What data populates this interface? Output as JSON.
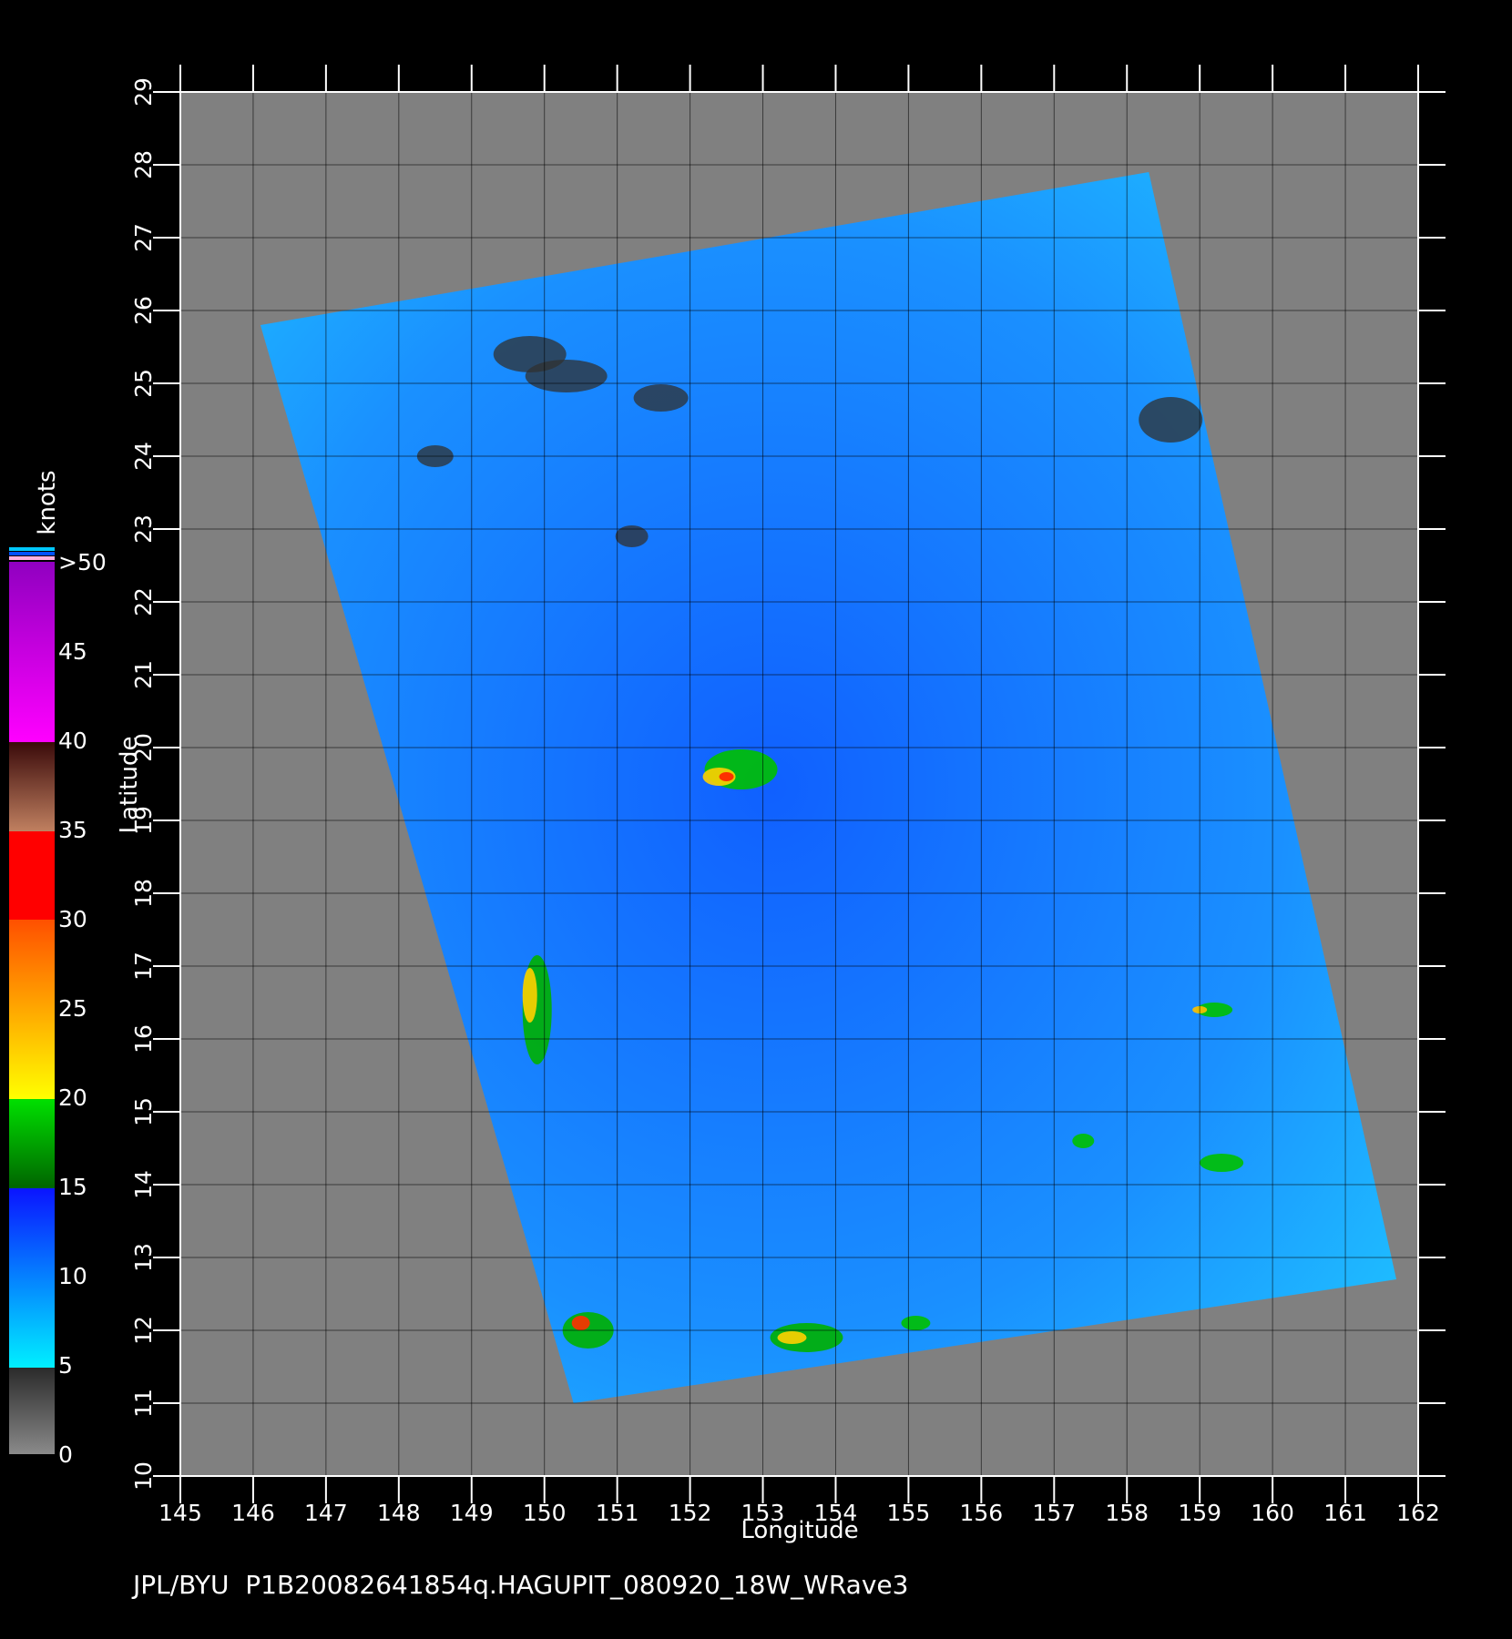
{
  "map": {
    "footer_text": "JPL/BYU  P1B20082641854q.HAGUPIT_080920_18W_WRave3",
    "x_axis_label": "Longitude",
    "y_axis_label": "Latitude",
    "longitude_ticks": [
      "145",
      "146",
      "147",
      "148",
      "149",
      "150",
      "151",
      "152",
      "153",
      "154",
      "155",
      "156",
      "157",
      "158",
      "159",
      "160",
      "161",
      "162"
    ],
    "latitude_ticks": [
      "10",
      "11",
      "12",
      "13",
      "14",
      "15",
      "16",
      "17",
      "18",
      "19",
      "20",
      "21",
      "22",
      "23",
      "24",
      "25",
      "26",
      "27",
      "28",
      "29"
    ],
    "extent": {
      "lon_min": 145,
      "lon_max": 162,
      "lat_min": 10,
      "lat_max": 29
    }
  },
  "colorbar": {
    "title": "knots",
    "tick_labels": [
      "0",
      "5",
      "10",
      "15",
      "20",
      "25",
      "30",
      "35",
      "40",
      "45",
      ">50"
    ],
    "colors": {
      "no_data": "#808080",
      "band_0_5": [
        "#2a2a2a",
        "#8a8a8a"
      ],
      "band_5_15": [
        "#0a14ff",
        "#00f0ff"
      ],
      "band_15_20": [
        "#006400",
        "#00e000"
      ],
      "band_20_30": [
        "#ff5000",
        "#ffff00"
      ],
      "band_30_35": "#ff0000",
      "band_35_40": [
        "#3a0a0a",
        "#c08060"
      ],
      "band_40_50": [
        "#9000c0",
        "#ff00ff"
      ]
    }
  },
  "swath": {
    "corner_lon_lat": [
      [
        146.1,
        25.8
      ],
      [
        158.3,
        27.9
      ],
      [
        161.7,
        12.7
      ],
      [
        150.4,
        11.0
      ]
    ]
  }
}
